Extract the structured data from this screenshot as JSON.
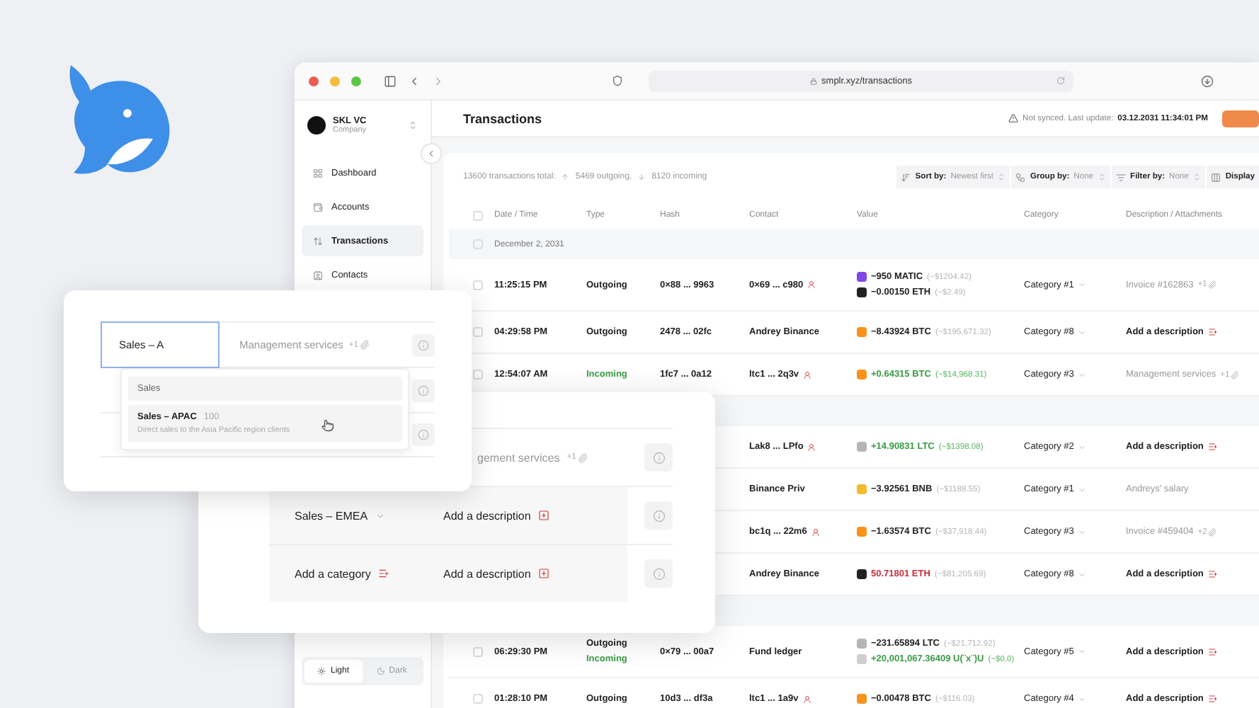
{
  "browser": {
    "url": "smplr.xyz/transactions"
  },
  "sidebar": {
    "org_name": "SKL VC",
    "org_type": "Company",
    "items": [
      {
        "label": "Dashboard",
        "selected": false
      },
      {
        "label": "Accounts",
        "selected": false
      },
      {
        "label": "Transactions",
        "selected": true
      },
      {
        "label": "Contacts",
        "selected": false
      }
    ],
    "theme": [
      {
        "label": "Light",
        "selected": true
      },
      {
        "label": "Dark",
        "selected": false
      }
    ]
  },
  "header": {
    "title": "Transactions",
    "sync_status": "Not synced. Last update:",
    "last_update": "03.12.2031 11:34:01 PM"
  },
  "stats": {
    "total": "13600 transactions total:",
    "outgoing": "5469 outgoing,",
    "incoming": "8120 incoming"
  },
  "toolbar": [
    {
      "label": "Sort by:",
      "value": "Newest first"
    },
    {
      "label": "Group by:",
      "value": "None"
    },
    {
      "label": "Filter by:",
      "value": "None"
    },
    {
      "label": "Display"
    }
  ],
  "table": {
    "select_all": {
      "checked": false
    },
    "columns": [
      "Date / Time",
      "Type",
      "Hash",
      "Contact",
      "Value",
      "Category",
      "Description / Attachments"
    ],
    "rows": [
      {
        "kind": "group",
        "label": "December 2, 2031",
        "checked": false
      },
      {
        "kind": "transaction",
        "checked": false,
        "time": "11:25:15 PM",
        "types": [
          {
            "label": "Outgoing",
            "incoming": false
          }
        ],
        "hash": "0×88 ... 9963",
        "contact": "0×69 ... c980",
        "address": true,
        "values": [
          {
            "amount": "−950 MATIC",
            "usd": "(~$1204.42)",
            "gain": false,
            "loss": false,
            "color": "#8247e5"
          },
          {
            "amount": "−0.00150 ETH",
            "usd": "(~$2.49)",
            "gain": false,
            "loss": false,
            "color": "#222222"
          }
        ],
        "category": "Category #1",
        "description": {
          "kind": "note",
          "text": "Invoice #162863",
          "attachments": "+1"
        }
      },
      {
        "kind": "transaction",
        "checked": false,
        "time": "04:29:58 PM",
        "types": [
          {
            "label": "Outgoing",
            "incoming": false
          }
        ],
        "hash": "2478 ... 02fc",
        "contact": "Andrey Binance",
        "address": false,
        "values": [
          {
            "amount": "−8.43924 BTC",
            "usd": "(~$195,671.32)",
            "gain": false,
            "loss": false,
            "color": "#f7931a"
          }
        ],
        "category": "Category #8",
        "description": {
          "kind": "add",
          "text": "Add a description"
        }
      },
      {
        "kind": "transaction",
        "checked": false,
        "time": "12:54:07 AM",
        "types": [
          {
            "label": "Incoming",
            "incoming": true
          }
        ],
        "hash": "1fc7 ... 0a12",
        "contact": "ltc1 ... 2q3v",
        "address": true,
        "values": [
          {
            "amount": "+0.64315 BTC",
            "usd": "(~$14,968.31)",
            "gain": true,
            "loss": false,
            "color": "#f7931a"
          }
        ],
        "category": "Category #3",
        "description": {
          "kind": "note",
          "text": "Management services",
          "attachments": "+1"
        }
      },
      {
        "kind": "group"
      },
      {
        "kind": "transaction",
        "contact": "Lak8 ... LPfo",
        "address": true,
        "values": [
          {
            "amount": "+14.90831 LTC",
            "usd": "(~$1398.08)",
            "gain": true,
            "loss": false,
            "color": "#b5b5b5"
          }
        ],
        "category": "Category #2",
        "description": {
          "kind": "add",
          "text": "Add a description"
        }
      },
      {
        "kind": "transaction",
        "contact": "Binance Priv",
        "address": false,
        "values": [
          {
            "amount": "−3.92561 BNB",
            "usd": "(~$1188.55)",
            "gain": false,
            "loss": false,
            "color": "#f3ba2f"
          }
        ],
        "category": "Category #1",
        "description": {
          "kind": "note",
          "text": "Andreys' salary"
        }
      },
      {
        "kind": "transaction",
        "contact": "bc1q ... 22m6",
        "address": true,
        "values": [
          {
            "amount": "−1.63574 BTC",
            "usd": "(~$37,918.44)",
            "gain": false,
            "loss": false,
            "color": "#f7931a"
          }
        ],
        "category": "Category #3",
        "description": {
          "kind": "note",
          "text": "Invoice #459404",
          "attachments": "+2"
        }
      },
      {
        "kind": "transaction",
        "contact": "Andrey Binance",
        "address": false,
        "values": [
          {
            "amount": "50.71801 ETH",
            "usd": "(~$81,205.69)",
            "gain": false,
            "loss": true,
            "color": "#222222"
          }
        ],
        "category": "Category #8",
        "description": {
          "kind": "add",
          "text": "Add a description"
        }
      },
      {
        "kind": "group"
      },
      {
        "kind": "transaction",
        "checked": false,
        "time": "06:29:30 PM",
        "types": [
          {
            "label": "Outgoing",
            "incoming": false
          },
          {
            "label": "Incoming",
            "incoming": true
          }
        ],
        "hash": "0×79 ... 00a7",
        "contact": "Fund ledger",
        "address": false,
        "values": [
          {
            "amount": "−231.65894 LTC",
            "usd": "(~$21,712.92)",
            "gain": false,
            "loss": false,
            "color": "#b5b5b5"
          },
          {
            "amount": "+20,001,067.36409 U(¨x¨)U",
            "usd": "(~$0.0)",
            "gain": true,
            "loss": false,
            "color": "#cfcfcf"
          }
        ],
        "category": "Category #5",
        "description": {
          "kind": "add",
          "text": "Add a description"
        }
      },
      {
        "kind": "transaction",
        "checked": false,
        "time": "01:28:10 PM",
        "types": [
          {
            "label": "Outgoing",
            "incoming": false
          }
        ],
        "hash": "10d3 ... df3a",
        "contact": "ltc1 ... 1a9v",
        "address": true,
        "values": [
          {
            "amount": "−0.00478 BTC",
            "usd": "(~$116.03)",
            "gain": false,
            "loss": false,
            "color": "#f7931a"
          }
        ],
        "category": "Category #4",
        "description": {
          "kind": "add",
          "text": "Add a description"
        }
      }
    ]
  },
  "category_editor": {
    "input": {
      "value": "Sales – A"
    },
    "description": {
      "text": "Management services",
      "attachments": "+1"
    },
    "options": [
      {
        "label": "Sales"
      },
      {
        "label": "Sales – APAC",
        "count": "100",
        "hint": "Direct sales to the Asia Pacific region clients"
      }
    ]
  },
  "bulk_editor": {
    "rows": [
      {
        "description": {
          "kind": "note",
          "text": "gement services",
          "attachments": "+1"
        }
      },
      {
        "category": {
          "kind": "value",
          "text": "Sales – EMEA"
        },
        "description": {
          "kind": "add",
          "text": "Add a description"
        }
      },
      {
        "category": {
          "kind": "add",
          "text": "Add a category"
        },
        "description": {
          "kind": "add",
          "text": "Add a description"
        }
      }
    ]
  }
}
